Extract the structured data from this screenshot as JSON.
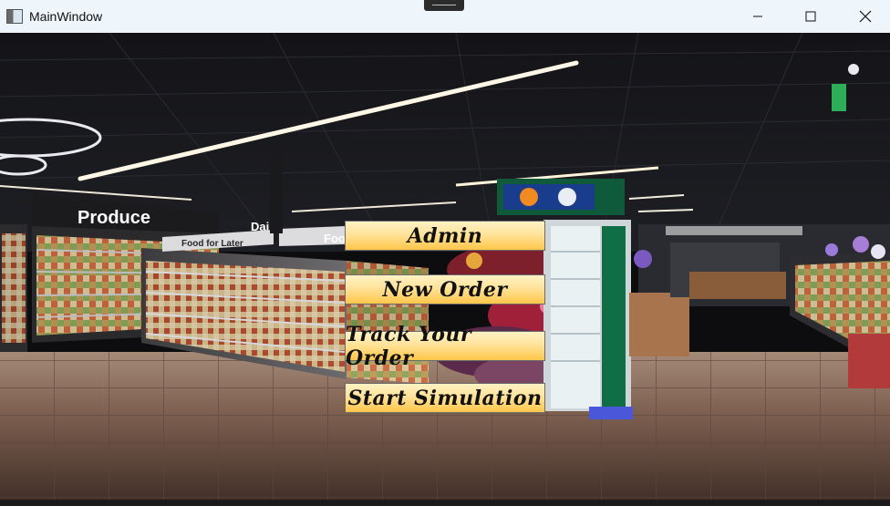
{
  "window": {
    "title": "MainWindow",
    "icons": {
      "app": "app-window-icon",
      "minimize": "minimize-icon",
      "maximize": "maximize-icon",
      "close": "close-icon"
    }
  },
  "scene": {
    "signs": {
      "produce": "Produce",
      "food_for_later": "Food for Later",
      "dairy_partial": "Dai",
      "food_partial": "Foo"
    }
  },
  "menu": {
    "admin": "Admin",
    "new_order": "New Order",
    "track_order": "Track Your Order",
    "start_simulation": "Start Simulation"
  },
  "colors": {
    "titlebar": "#eef5fb",
    "button_top": "#fff2c4",
    "button_bottom": "#ffc64a",
    "button_border": "#6b6b6b"
  }
}
